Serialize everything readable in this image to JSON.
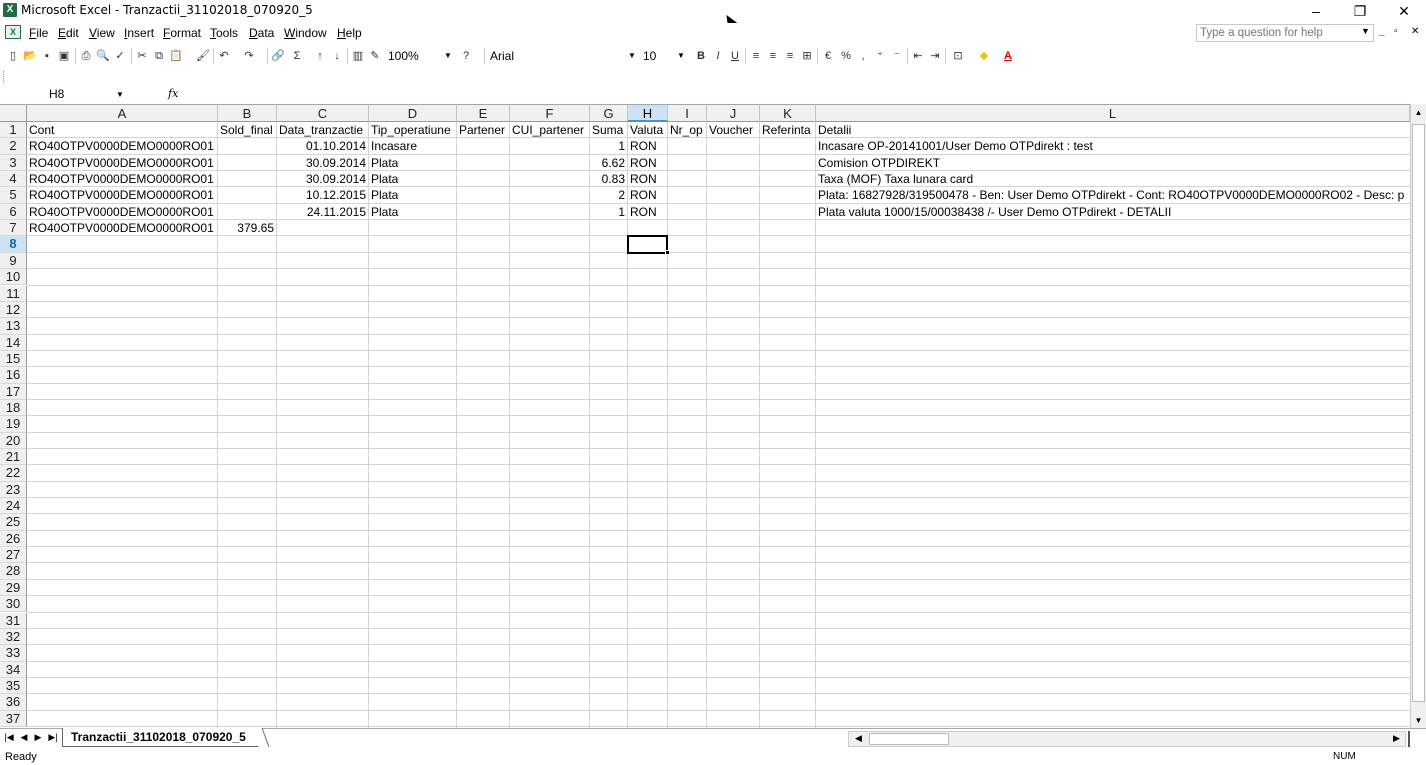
{
  "window": {
    "title": "Microsoft Excel - Tranzactii_31102018_070920_5",
    "app_icon": "X",
    "min": "–",
    "max": "❐",
    "close": "✕"
  },
  "menubar": {
    "items": [
      "File",
      "Edit",
      "View",
      "Insert",
      "Format",
      "Tools",
      "Data",
      "Window",
      "Help"
    ],
    "help_placeholder": "Type a question for help",
    "mdi_min": "_",
    "mdi_restore": "▫",
    "mdi_close": "✕"
  },
  "toolbar": {
    "zoom": "100%",
    "font": "Arial",
    "font_size": "10",
    "bold": "B",
    "italic": "I",
    "underline": "U",
    "percent": "%",
    "comma": ",",
    "sum": "Σ"
  },
  "formula_bar": {
    "name_box": "H8",
    "fx": "fx",
    "formula": ""
  },
  "sheet": {
    "columns": [
      "A",
      "B",
      "C",
      "D",
      "E",
      "F",
      "G",
      "H",
      "I",
      "J",
      "K",
      "L"
    ],
    "selected_column": "H",
    "selected_row": 8,
    "row_numbers": [
      1,
      2,
      3,
      4,
      5,
      6,
      7,
      8,
      9,
      10,
      11,
      12,
      13,
      14,
      15,
      16,
      17,
      18,
      19,
      20,
      21,
      22,
      23,
      24,
      25,
      26,
      27,
      28,
      29,
      30,
      31,
      32,
      33,
      34,
      35,
      36,
      37
    ],
    "header_row": [
      "Cont",
      "Sold_final",
      "Data_tranzactie",
      "Tip_operatiune",
      "Partener",
      "CUI_partener",
      "Suma",
      "Valuta",
      "Nr_op",
      "Voucher",
      "Referinta",
      "Detalii"
    ],
    "rows": [
      [
        "RO40OTPV0000DEMO0000RO01",
        "",
        "01.10.2014",
        "Incasare",
        "",
        "",
        "1",
        "RON",
        "",
        "",
        "",
        "Incasare OP-20141001/User Demo OTPdirekt : test"
      ],
      [
        "RO40OTPV0000DEMO0000RO01",
        "",
        "30.09.2014",
        "Plata",
        "",
        "",
        "6.62",
        "RON",
        "",
        "",
        "",
        "Comision OTPDIREKT"
      ],
      [
        "RO40OTPV0000DEMO0000RO01",
        "",
        "30.09.2014",
        "Plata",
        "",
        "",
        "0.83",
        "RON",
        "",
        "",
        "",
        "Taxa (MOF) Taxa lunara card"
      ],
      [
        "RO40OTPV0000DEMO0000RO01",
        "",
        "10.12.2015",
        "Plata",
        "",
        "",
        "2",
        "RON",
        "",
        "",
        "",
        "Plata: 16827928/319500478 - Ben: User Demo OTPdirekt - Cont: RO40OTPV0000DEMO0000RO02 - Desc: p"
      ],
      [
        "RO40OTPV0000DEMO0000RO01",
        "",
        "24.11.2015",
        "Plata",
        "",
        "",
        "1",
        "RON",
        "",
        "",
        "",
        "Plata valuta 1000/15/00038438 /- User Demo OTPdirekt - DETALII"
      ],
      [
        "RO40OTPV0000DEMO0000RO01",
        "379.65",
        "",
        "",
        "",
        "",
        "",
        "",
        "",
        "",
        "",
        ""
      ]
    ]
  },
  "tabs": {
    "sheet_name": "Tranzactii_31102018_070920_5"
  },
  "status": {
    "text": "Ready",
    "num": "NUM"
  }
}
